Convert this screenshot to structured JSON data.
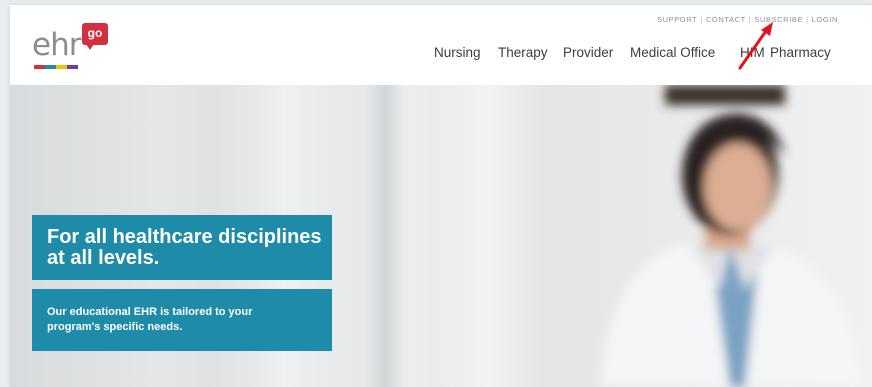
{
  "brand": {
    "logo_text": "ehr",
    "logo_badge": "go",
    "logo_colors": [
      "#d32f3f",
      "#1e8ba8",
      "#f5c400",
      "#6b3fa0",
      "#3aa655"
    ]
  },
  "utility_nav": {
    "items": [
      "SUPPORT",
      "CONTACT",
      "SUBSCRIBE",
      "LOGIN"
    ],
    "separator": "|"
  },
  "main_nav": {
    "items": [
      "Nursing",
      "Therapy",
      "Provider",
      "Medical Office",
      "HIM",
      "Pharmacy"
    ]
  },
  "hero": {
    "headline": "For all healthcare disciplines at all levels.",
    "subtext": "Our educational EHR is tailored to your program's specific needs.",
    "accent_color": "#1e8ba8"
  },
  "annotation": {
    "type": "red arrow",
    "color": "#e2131b",
    "target": "SUBSCRIBE"
  }
}
